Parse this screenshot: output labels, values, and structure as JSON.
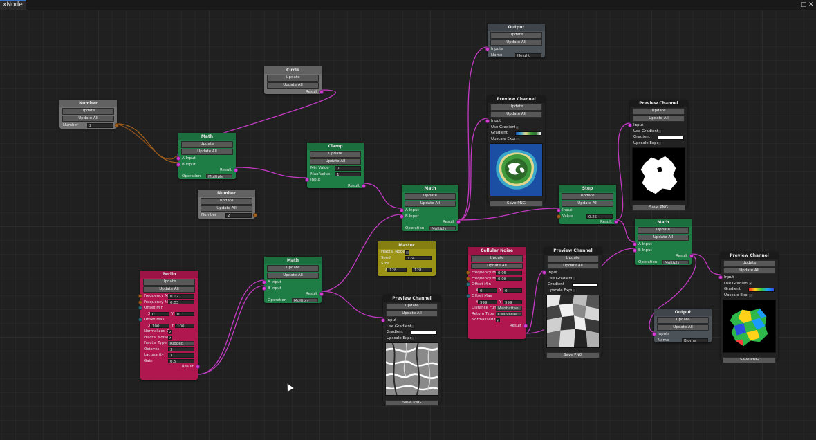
{
  "app": {
    "tab_label": "xNode",
    "menu_icon": "kebab-menu-icon",
    "maximize_icon": "maximize-icon",
    "close_icon": "close-icon"
  },
  "colors": {
    "wire": "#c23ac2",
    "accent_tab": "#3a79c9",
    "math_node": "#1e7d45",
    "perlin_node": "#b0174f",
    "master_node": "#9a9316"
  },
  "common": {
    "update": "Update",
    "update_all": "Update All",
    "save_png": "Save PNG"
  },
  "circle": {
    "title": "Circle",
    "result": "Result"
  },
  "number1": {
    "title": "Number",
    "label": "Number",
    "value": "2"
  },
  "number2": {
    "title": "Number",
    "label": "Number",
    "value": "2"
  },
  "math1": {
    "title": "Math",
    "a_input": "A Input",
    "b_input": "B Input",
    "result": "Result",
    "operation_label": "Operation",
    "operation_value": "Multiply"
  },
  "math2": {
    "title": "Math",
    "a_input": "A Input",
    "b_input": "B Input",
    "result": "Result",
    "operation_label": "Operation",
    "operation_value": "Multiply"
  },
  "math3": {
    "title": "Math",
    "a_input": "A Input",
    "b_input": "B Input",
    "result": "Result",
    "operation_label": "Operation",
    "operation_value": "Multiply"
  },
  "math4": {
    "title": "Math",
    "a_input": "A Input",
    "b_input": "B Input",
    "result": "Result",
    "operation_label": "Operation",
    "operation_value": "Multiply"
  },
  "clamp": {
    "title": "Clamp",
    "min_label": "Min Value",
    "min_value": "0",
    "max_label": "Max Value",
    "max_value": "1",
    "input": "Input",
    "result": "Result"
  },
  "output1": {
    "title": "Output",
    "inputs": "Inputs",
    "name_label": "Name",
    "name_value": "Height"
  },
  "output2": {
    "title": "Output",
    "inputs": "Inputs",
    "name_label": "Name",
    "name_value": "Biome"
  },
  "preview1": {
    "title": "Preview Channel",
    "input": "Input",
    "use_gradient": "Use Gradient",
    "use_gradient_checked": "✓",
    "gradient": "Gradient",
    "upscale": "Upscale Export"
  },
  "preview2": {
    "title": "Preview Channel",
    "input": "Input",
    "use_gradient": "Use Gradient",
    "use_gradient_checked": "",
    "gradient": "Gradient",
    "upscale": "Upscale Export"
  },
  "preview3": {
    "title": "Preview Channel",
    "input": "Input",
    "use_gradient": "Use Gradient",
    "use_gradient_checked": "",
    "gradient": "Gradient",
    "upscale": "Upscale Export"
  },
  "preview4": {
    "title": "Preview Channel",
    "input": "Input",
    "use_gradient": "Use Gradient",
    "use_gradient_checked": "",
    "gradient": "Gradient",
    "upscale": "Upscale Export"
  },
  "preview5": {
    "title": "Preview Channel",
    "input": "Input",
    "use_gradient": "Use Gradient",
    "use_gradient_checked": "✓",
    "gradient": "Gradient",
    "upscale": "Upscale Export"
  },
  "step": {
    "title": "Step",
    "input": "Input",
    "value_label": "Value",
    "value": "0.25",
    "result": "Result"
  },
  "master": {
    "title": "Master",
    "fractal_node": "Fractal Node",
    "seed_label": "Seed",
    "seed_value": "124",
    "size_label": "Size",
    "x_label": "X",
    "x_value": "128",
    "y_value": "128"
  },
  "perlin": {
    "title": "Perlin",
    "freq_min_label": "Frequency Min",
    "freq_min": "0.02",
    "freq_max_label": "Frequency Max",
    "freq_max": "0.03",
    "offset_min_label": "Offset Min",
    "offset_min_x": "0",
    "offset_min_y": "0",
    "offset_max_label": "Offset Max",
    "offset_max_x": "100",
    "offset_max_y": "100",
    "normalized_label": "Normalized Ou",
    "normalized_checked": "✓",
    "fractal_noise_label": "Fractal Noise",
    "fractal_noise_checked": "✓",
    "fractal_type_label": "Fractal Type",
    "fractal_type": "Ridged",
    "octaves_label": "Octaves",
    "octaves": "3",
    "lacunarity_label": "Lacunarity",
    "lacunarity": "3",
    "gain_label": "Gain",
    "gain": "0.5",
    "result": "Result",
    "x": "X",
    "y": "Y"
  },
  "cellular": {
    "title": "Cellular Noise",
    "freq_min_label": "Frequency Min",
    "freq_min": "0.05",
    "freq_max_label": "Frequency Max",
    "freq_max": "0.08",
    "offset_min_label": "Offset Min",
    "offset_min_x": "0",
    "offset_min_y": "0",
    "offset_max_label": "Offset Max",
    "offset_max_x": "999",
    "offset_max_y": "999",
    "distance_label": "Distance Func",
    "distance_value": "Manhattan",
    "return_label": "Return Type",
    "return_value": "Cell Value",
    "normalized_label": "Normalized Ou",
    "normalized_checked": "✓",
    "result": "Result",
    "x": "X",
    "y": "Y"
  }
}
